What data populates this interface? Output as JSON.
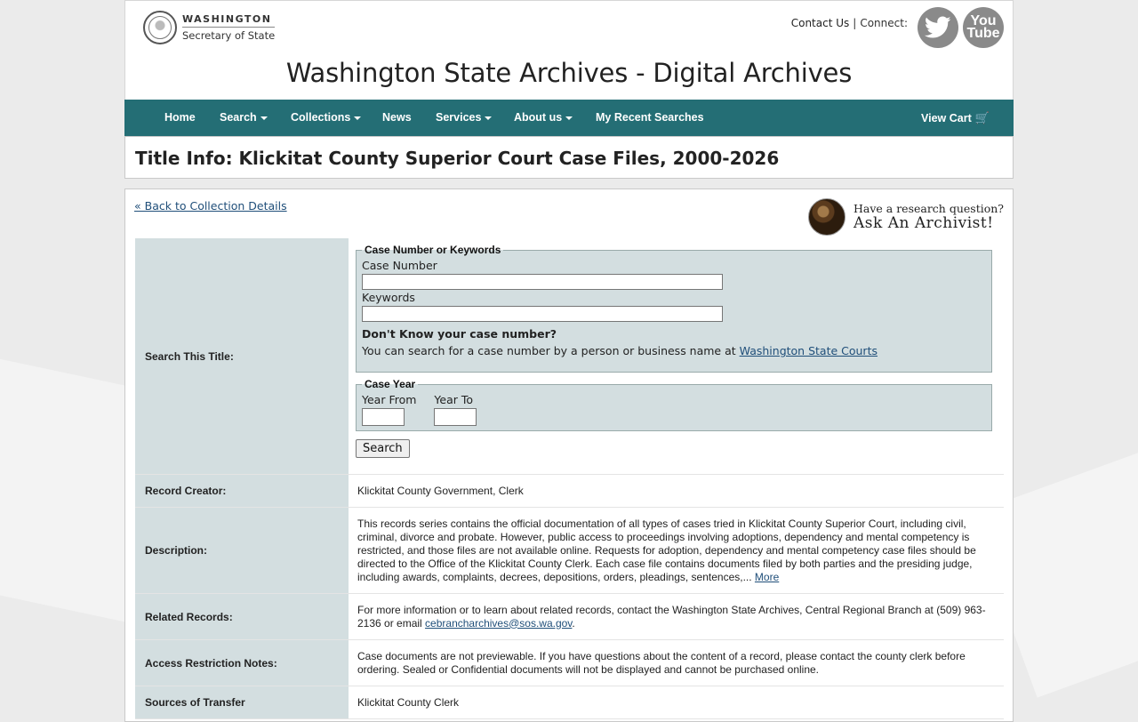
{
  "header": {
    "logo_line1": "WASHINGTON",
    "logo_line2": "Secretary of State",
    "contact_us": "Contact Us",
    "separator": "|",
    "connect": "Connect:",
    "twitter_icon": "twitter-bird-icon",
    "youtube_text": "You\nTube",
    "site_title": "Washington State Archives - Digital Archives"
  },
  "nav": {
    "items": [
      {
        "label": "Home",
        "dropdown": false
      },
      {
        "label": "Search",
        "dropdown": true
      },
      {
        "label": "Collections",
        "dropdown": true
      },
      {
        "label": "News",
        "dropdown": false
      },
      {
        "label": "Services",
        "dropdown": true
      },
      {
        "label": "About us",
        "dropdown": true
      },
      {
        "label": "My Recent Searches",
        "dropdown": false
      }
    ],
    "cart": "View Cart",
    "cart_icon": "shopping-cart-icon"
  },
  "title_box": {
    "title": "Title Info: Klickitat County Superior Court Case Files, 2000-2026"
  },
  "content": {
    "back_link": "« Back to Collection Details",
    "ask_line1": "Have a research question?",
    "ask_line2": "Ask An Archivist!",
    "search": {
      "label": "Search This Title:",
      "case_legend": "Case Number or Keywords",
      "case_number_label": "Case Number",
      "case_number_value": "",
      "keywords_label": "Keywords",
      "keywords_value": "",
      "dont_know": "Don't Know your case number?",
      "help_text": "You can search for a case number by a person or business name at ",
      "help_link": "Washington State Courts",
      "year_legend": "Case Year",
      "year_from_label": "Year From",
      "year_from_value": "",
      "year_to_label": "Year To",
      "year_to_value": "",
      "button": "Search"
    },
    "record_creator": {
      "label": "Record Creator:",
      "value": "Klickitat County Government, Clerk"
    },
    "description": {
      "label": "Description:",
      "value": "This records series contains the official documentation of all types of cases tried in Klickitat County Superior Court, including civil, criminal, divorce and probate. However, public access to proceedings involving adoptions, dependency and mental competency is restricted, and those files are not available online. Requests for adoption, dependency and mental competency case files should be directed to the Office of the Klickitat County Clerk. Each case file contains documents filed by both parties and the presiding judge, including awards, complaints, decrees, depositions, orders, pleadings, sentences,... ",
      "more": "More"
    },
    "related_records": {
      "label": "Related Records:",
      "value": "For more information or to learn about related records, contact the Washington State Archives, Central Regional Branch at (509) 963-2136 or email ",
      "email": "cebrancharchives@sos.wa.gov",
      "suffix": "."
    },
    "access_restriction": {
      "label": "Access Restriction Notes:",
      "value": "Case documents are not previewable. If you have questions about the content of a record, please contact the county clerk before ordering. Sealed or Confidential documents will not be displayed and cannot be purchased online."
    },
    "sources_of_transfer": {
      "label": "Sources of Transfer",
      "value": "Klickitat County Clerk"
    }
  }
}
